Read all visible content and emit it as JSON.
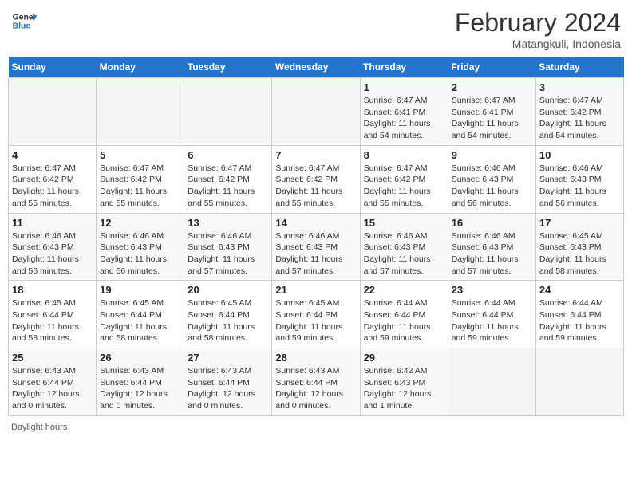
{
  "header": {
    "logo_text_general": "General",
    "logo_text_blue": "Blue",
    "main_title": "February 2024",
    "subtitle": "Matangkuli, Indonesia"
  },
  "weekdays": [
    "Sunday",
    "Monday",
    "Tuesday",
    "Wednesday",
    "Thursday",
    "Friday",
    "Saturday"
  ],
  "weeks": [
    [
      {
        "num": "",
        "detail": ""
      },
      {
        "num": "",
        "detail": ""
      },
      {
        "num": "",
        "detail": ""
      },
      {
        "num": "",
        "detail": ""
      },
      {
        "num": "1",
        "detail": "Sunrise: 6:47 AM\nSunset: 6:41 PM\nDaylight: 11 hours and 54 minutes."
      },
      {
        "num": "2",
        "detail": "Sunrise: 6:47 AM\nSunset: 6:41 PM\nDaylight: 11 hours and 54 minutes."
      },
      {
        "num": "3",
        "detail": "Sunrise: 6:47 AM\nSunset: 6:42 PM\nDaylight: 11 hours and 54 minutes."
      }
    ],
    [
      {
        "num": "4",
        "detail": "Sunrise: 6:47 AM\nSunset: 6:42 PM\nDaylight: 11 hours and 55 minutes."
      },
      {
        "num": "5",
        "detail": "Sunrise: 6:47 AM\nSunset: 6:42 PM\nDaylight: 11 hours and 55 minutes."
      },
      {
        "num": "6",
        "detail": "Sunrise: 6:47 AM\nSunset: 6:42 PM\nDaylight: 11 hours and 55 minutes."
      },
      {
        "num": "7",
        "detail": "Sunrise: 6:47 AM\nSunset: 6:42 PM\nDaylight: 11 hours and 55 minutes."
      },
      {
        "num": "8",
        "detail": "Sunrise: 6:47 AM\nSunset: 6:42 PM\nDaylight: 11 hours and 55 minutes."
      },
      {
        "num": "9",
        "detail": "Sunrise: 6:46 AM\nSunset: 6:43 PM\nDaylight: 11 hours and 56 minutes."
      },
      {
        "num": "10",
        "detail": "Sunrise: 6:46 AM\nSunset: 6:43 PM\nDaylight: 11 hours and 56 minutes."
      }
    ],
    [
      {
        "num": "11",
        "detail": "Sunrise: 6:46 AM\nSunset: 6:43 PM\nDaylight: 11 hours and 56 minutes."
      },
      {
        "num": "12",
        "detail": "Sunrise: 6:46 AM\nSunset: 6:43 PM\nDaylight: 11 hours and 56 minutes."
      },
      {
        "num": "13",
        "detail": "Sunrise: 6:46 AM\nSunset: 6:43 PM\nDaylight: 11 hours and 57 minutes."
      },
      {
        "num": "14",
        "detail": "Sunrise: 6:46 AM\nSunset: 6:43 PM\nDaylight: 11 hours and 57 minutes."
      },
      {
        "num": "15",
        "detail": "Sunrise: 6:46 AM\nSunset: 6:43 PM\nDaylight: 11 hours and 57 minutes."
      },
      {
        "num": "16",
        "detail": "Sunrise: 6:46 AM\nSunset: 6:43 PM\nDaylight: 11 hours and 57 minutes."
      },
      {
        "num": "17",
        "detail": "Sunrise: 6:45 AM\nSunset: 6:43 PM\nDaylight: 11 hours and 58 minutes."
      }
    ],
    [
      {
        "num": "18",
        "detail": "Sunrise: 6:45 AM\nSunset: 6:44 PM\nDaylight: 11 hours and 58 minutes."
      },
      {
        "num": "19",
        "detail": "Sunrise: 6:45 AM\nSunset: 6:44 PM\nDaylight: 11 hours and 58 minutes."
      },
      {
        "num": "20",
        "detail": "Sunrise: 6:45 AM\nSunset: 6:44 PM\nDaylight: 11 hours and 58 minutes."
      },
      {
        "num": "21",
        "detail": "Sunrise: 6:45 AM\nSunset: 6:44 PM\nDaylight: 11 hours and 59 minutes."
      },
      {
        "num": "22",
        "detail": "Sunrise: 6:44 AM\nSunset: 6:44 PM\nDaylight: 11 hours and 59 minutes."
      },
      {
        "num": "23",
        "detail": "Sunrise: 6:44 AM\nSunset: 6:44 PM\nDaylight: 11 hours and 59 minutes."
      },
      {
        "num": "24",
        "detail": "Sunrise: 6:44 AM\nSunset: 6:44 PM\nDaylight: 11 hours and 59 minutes."
      }
    ],
    [
      {
        "num": "25",
        "detail": "Sunrise: 6:43 AM\nSunset: 6:44 PM\nDaylight: 12 hours and 0 minutes."
      },
      {
        "num": "26",
        "detail": "Sunrise: 6:43 AM\nSunset: 6:44 PM\nDaylight: 12 hours and 0 minutes."
      },
      {
        "num": "27",
        "detail": "Sunrise: 6:43 AM\nSunset: 6:44 PM\nDaylight: 12 hours and 0 minutes."
      },
      {
        "num": "28",
        "detail": "Sunrise: 6:43 AM\nSunset: 6:44 PM\nDaylight: 12 hours and 0 minutes."
      },
      {
        "num": "29",
        "detail": "Sunrise: 6:42 AM\nSunset: 6:43 PM\nDaylight: 12 hours and 1 minute."
      },
      {
        "num": "",
        "detail": ""
      },
      {
        "num": "",
        "detail": ""
      }
    ]
  ],
  "footer": {
    "daylight_label": "Daylight hours"
  }
}
